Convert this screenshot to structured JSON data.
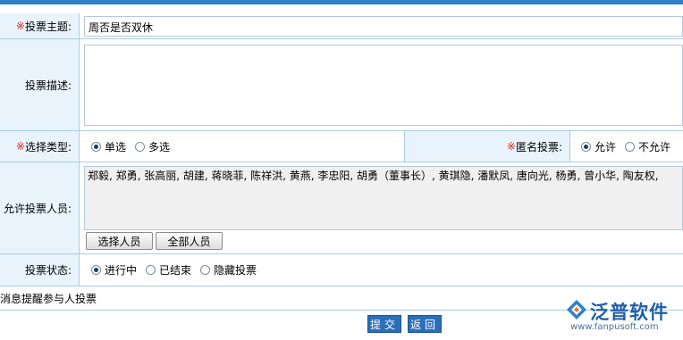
{
  "form": {
    "subject": {
      "required_mark": "※",
      "label": "投票主题:",
      "value": "周否是否双休"
    },
    "description": {
      "label": "投票描述:",
      "value": ""
    },
    "vote_type": {
      "required_mark": "※",
      "label": "选择类型:",
      "options": [
        {
          "label": "单选",
          "selected": true
        },
        {
          "label": "多选",
          "selected": false
        }
      ]
    },
    "anonymous": {
      "required_mark": "※",
      "label": "匿名投票:",
      "options": [
        {
          "label": "允许",
          "selected": true
        },
        {
          "label": "不允许",
          "selected": false
        }
      ]
    },
    "participants": {
      "label": "允许投票人员:",
      "value": "郑毅, 郑勇, 张高丽, 胡建, 蒋晓菲, 陈祥洪, 黄燕, 李忠阳, 胡勇（董事长）, 黄琪隐, 潘默凤, 唐向光, 杨勇, 曾小华, 陶友权,",
      "select_button": "选择人员",
      "all_button": "全部人员"
    },
    "status": {
      "label": "投票状态:",
      "options": [
        {
          "label": "进行中",
          "selected": true
        },
        {
          "label": "已结束",
          "selected": false
        },
        {
          "label": "隐藏投票",
          "selected": false
        }
      ]
    },
    "remind_text": "消息提醒参与人投票",
    "submit_label": "提交",
    "back_label": "返回"
  },
  "branding": {
    "name": "泛普软件",
    "url": "www.fanpusoft.com"
  },
  "colors": {
    "accent": "#2f82c7",
    "label_bg": "#e8f3fc",
    "required": "#e0221b",
    "button_blue": "#2b6fba"
  }
}
